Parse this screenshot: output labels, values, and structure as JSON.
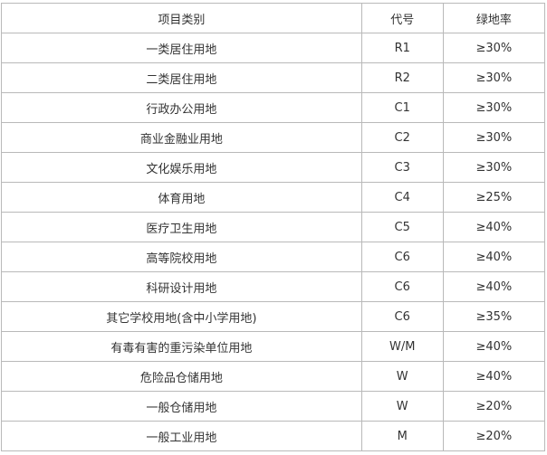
{
  "table": {
    "headers": [
      "项目类别",
      "代号",
      "绿地率"
    ],
    "rows": [
      [
        "一类居住用地",
        "R1",
        "≥30%"
      ],
      [
        "二类居住用地",
        "R2",
        "≥30%"
      ],
      [
        "行政办公用地",
        "C1",
        "≥30%"
      ],
      [
        "商业金融业用地",
        "C2",
        "≥30%"
      ],
      [
        "文化娱乐用地",
        "C3",
        "≥30%"
      ],
      [
        "体育用地",
        "C4",
        "≥25%"
      ],
      [
        "医疗卫生用地",
        "C5",
        "≥40%"
      ],
      [
        "高等院校用地",
        "C6",
        "≥40%"
      ],
      [
        "科研设计用地",
        "C6",
        "≥40%"
      ],
      [
        "其它学校用地(含中小学用地)",
        "C6",
        "≥35%"
      ],
      [
        "有毒有害的重污染单位用地",
        "W/M",
        "≥40%"
      ],
      [
        "危险品仓储用地",
        "W",
        "≥40%"
      ],
      [
        "一般仓储用地",
        "W",
        "≥20%"
      ],
      [
        "一般工业用地",
        "M",
        "≥20%"
      ]
    ]
  },
  "colors": {
    "border": "#b9b9b9",
    "text": "#333333",
    "background": "#ffffff"
  }
}
